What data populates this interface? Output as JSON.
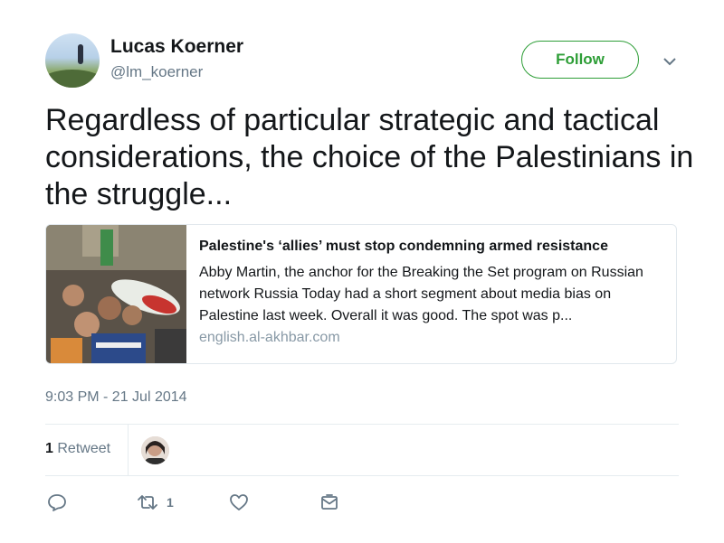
{
  "user": {
    "name": "Lucas Koerner",
    "handle": "@lm_koerner",
    "avatar_icon": "profile-photo"
  },
  "follow_label": "Follow",
  "tweet": {
    "text": "Regardless of particular strategic and tactical considerations, the choice of the Palestinians in the struggle..."
  },
  "card": {
    "title": "Palestine's ‘allies’ must stop condemning armed resistance",
    "description": "Abby Martin, the anchor for the Breaking the Set program on Russian network Russia Today had a short segment about media bias on Palestine last week. Overall it was good. The spot was p...",
    "domain": "english.al-akhbar.com"
  },
  "timestamp": "9:03 PM - 21 Jul 2014",
  "stats": {
    "retweet_count": "1",
    "retweet_label": "Retweet"
  },
  "actions": {
    "reply_icon": "reply-icon",
    "retweet_icon": "retweet-icon",
    "retweet_count": "1",
    "like_icon": "heart-icon",
    "dm_icon": "envelope-icon"
  },
  "colors": {
    "follow_green": "#2e9e37",
    "secondary_text": "#657786",
    "domain_text": "#8899a6"
  }
}
